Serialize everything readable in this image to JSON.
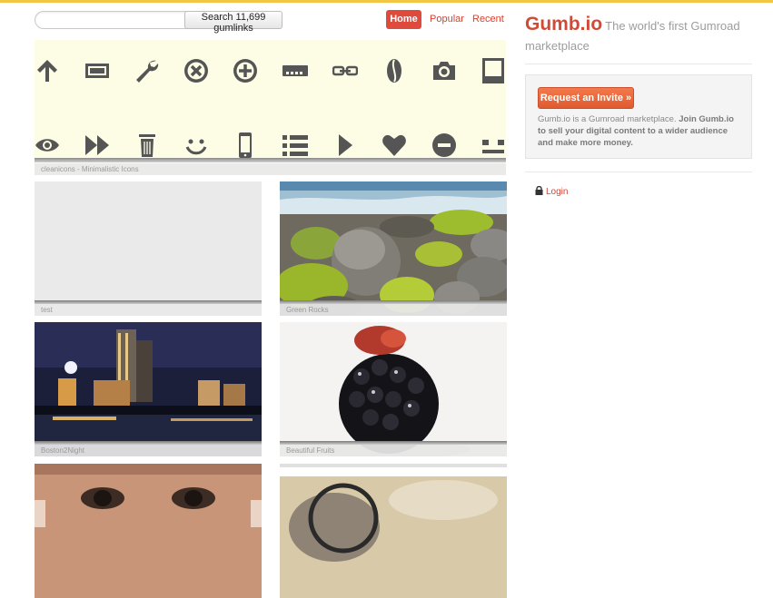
{
  "search": {
    "placeholder": "",
    "button_label": "Search 11,699 gumlinks"
  },
  "nav": {
    "home": "Home",
    "popular": "Popular",
    "recent": "Recent"
  },
  "featured": {
    "caption": "cleanicons - Minimalistic Icons",
    "icons": [
      "arrow-up-icon",
      "battery-icon",
      "wrench-icon",
      "circle-x-icon",
      "circle-plus-icon",
      "more-icon",
      "link-icon",
      "coffee-bean-icon",
      "camera-icon",
      "tablet-icon",
      "eye-icon",
      "fast-forward-icon",
      "trash-icon",
      "smile-icon",
      "phone-icon",
      "list-icon",
      "play-icon",
      "heart-icon",
      "circle-minus-icon",
      "neutral-face-icon"
    ]
  },
  "cards": [
    {
      "caption": "test",
      "image": "blank"
    },
    {
      "caption": "Green Rocks",
      "image": "green-rocks-photo"
    },
    {
      "caption": "Boston2Night",
      "image": "boston-night-photo"
    },
    {
      "caption": "Beautiful Fruits",
      "image": "blackberry-photo"
    },
    {
      "caption": "",
      "image": "baby-face-photo"
    },
    {
      "caption": "",
      "image": "magnifier-photo"
    }
  ],
  "sidebar": {
    "brand": "Gumb.io",
    "tagline": "The world's first Gumroad marketplace",
    "invite_button": "Request an Invite »",
    "invite_text_plain": "Gumb.io is a Gumroad marketplace. ",
    "invite_text_bold": "Join Gumb.io to sell your digital content to a wider audience and make more money.",
    "login": "Login"
  },
  "colors": {
    "accent": "#de4a3c",
    "brand": "#d24a36",
    "topline": "#f2c542",
    "banner": "#fdfde6"
  }
}
